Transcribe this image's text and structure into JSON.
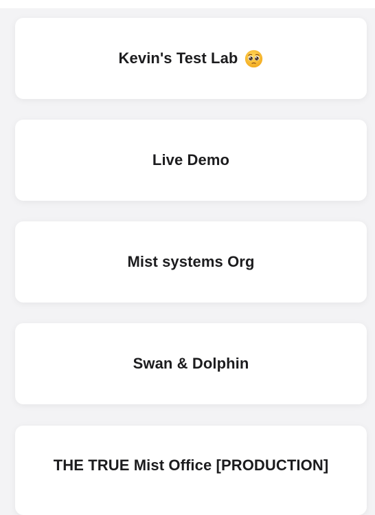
{
  "organizations": [
    {
      "name": "Kevin's Test Lab",
      "emoji": "pleading-face-emoji"
    },
    {
      "name": "Live Demo"
    },
    {
      "name": "Mist systems Org"
    },
    {
      "name": "Swan & Dolphin"
    },
    {
      "name": "THE TRUE Mist Office [PRODUCTION]"
    }
  ],
  "colors": {
    "background": "#f3f3f5",
    "card": "#ffffff",
    "text": "#1c1c1e",
    "emoji_face": "#f7b52c"
  }
}
